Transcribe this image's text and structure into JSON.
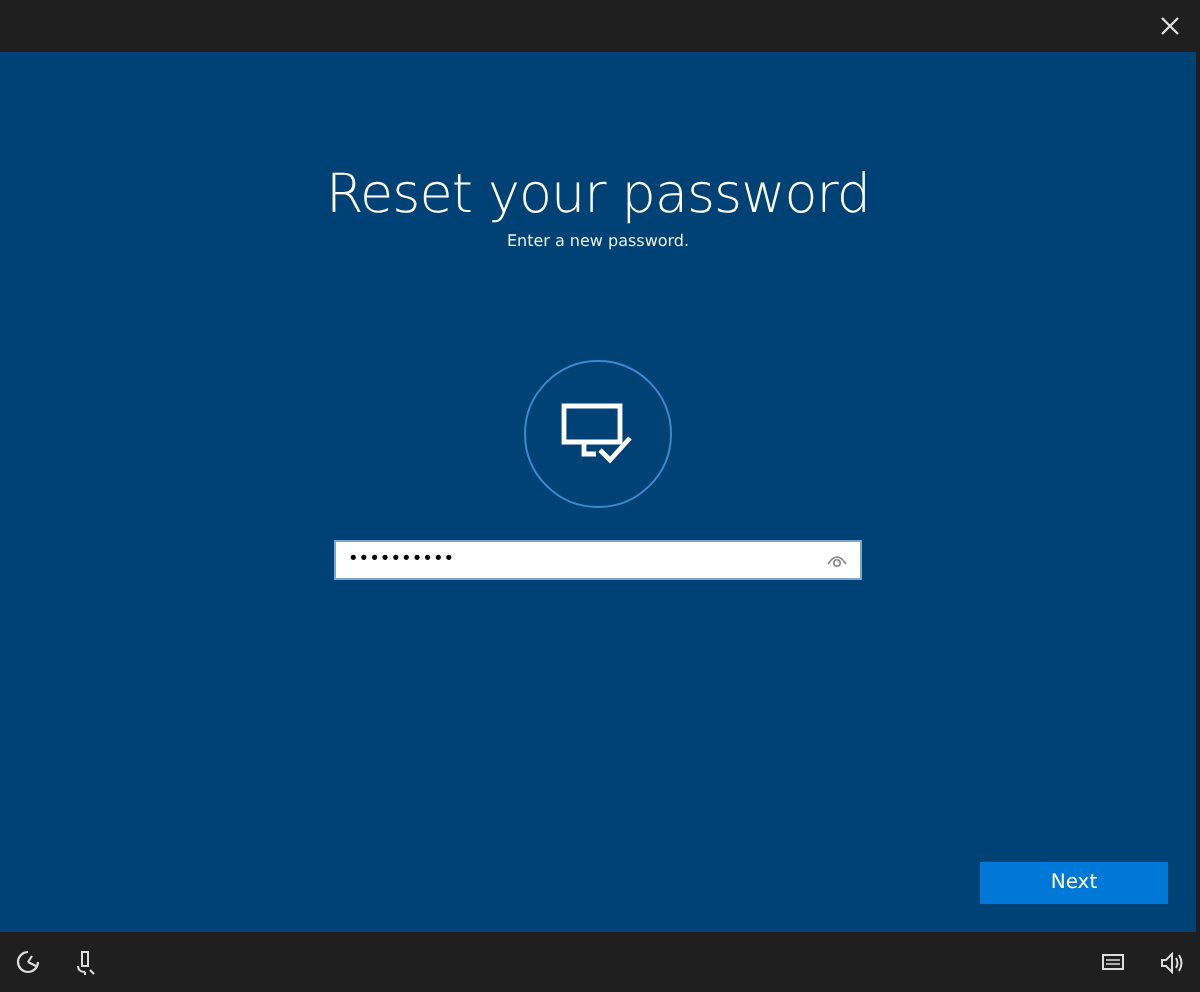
{
  "title": "Reset your password",
  "subtitle": "Enter a new password.",
  "password_field": {
    "value": "••••••••••"
  },
  "next_button": "Next"
}
